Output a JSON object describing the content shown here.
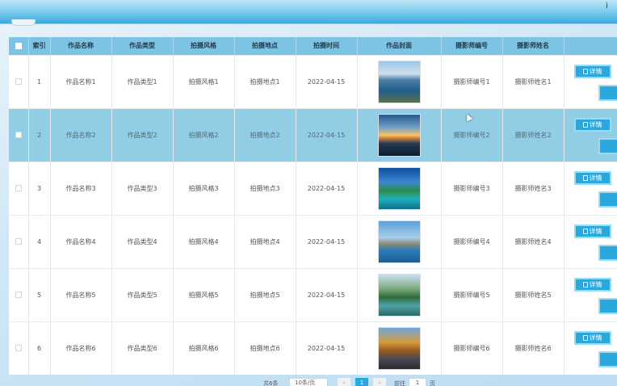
{
  "window": {
    "corner_glyph": "i"
  },
  "table": {
    "headers": [
      "索引",
      "作品名称",
      "作品类型",
      "拍摄风格",
      "拍摄地点",
      "拍摄时间",
      "作品封面",
      "摄影师编号",
      "摄影师姓名"
    ],
    "rows": [
      {
        "index": "1",
        "name": "作品名称1",
        "type": "作品类型1",
        "style": "拍摄风格1",
        "place": "拍摄地点1",
        "date": "2022-04-15",
        "cover": "lake-landscape-photo",
        "photographer_no": "摄影师编号1",
        "photographer_name": "摄影师姓名1",
        "selected": false
      },
      {
        "index": "2",
        "name": "作品名称2",
        "type": "作品类型2",
        "style": "拍摄风格2",
        "place": "拍摄地点2",
        "date": "2022-04-15",
        "cover": "sunset-sea-photo",
        "photographer_no": "摄影师编号2",
        "photographer_name": "摄影师姓名2",
        "selected": true
      },
      {
        "index": "3",
        "name": "作品名称3",
        "type": "作品类型3",
        "style": "拍摄风格3",
        "place": "拍摄地点3",
        "date": "2022-04-15",
        "cover": "tropical-island-photo",
        "photographer_no": "摄影师编号3",
        "photographer_name": "摄影师姓名3",
        "selected": false
      },
      {
        "index": "4",
        "name": "作品名称4",
        "type": "作品类型4",
        "style": "拍摄风格4",
        "place": "拍摄地点4",
        "date": "2022-04-15",
        "cover": "mountain-lake-photo",
        "photographer_no": "摄影师编号4",
        "photographer_name": "摄影师姓名4",
        "selected": false
      },
      {
        "index": "5",
        "name": "作品名称5",
        "type": "作品类型5",
        "style": "拍摄风格5",
        "place": "拍摄地点5",
        "date": "2022-04-15",
        "cover": "river-valley-photo",
        "photographer_no": "摄影师编号5",
        "photographer_name": "摄影师姓名5",
        "selected": false
      },
      {
        "index": "6",
        "name": "作品名称6",
        "type": "作品类型6",
        "style": "拍摄风格6",
        "place": "拍摄地点6",
        "date": "2022-04-15",
        "cover": "autumn-road-photo",
        "photographer_no": "摄影师编号6",
        "photographer_name": "摄影师姓名6",
        "selected": false
      }
    ],
    "detail_label": "详情"
  },
  "pager": {
    "total_label": "共6条",
    "page_size": "10条/页",
    "prev": "‹",
    "current": "1",
    "next": "›",
    "goto_label": "前往",
    "goto_value": "1",
    "goto_unit": "页"
  },
  "colors": {
    "accent": "#2aa8dd",
    "header": "#7dc3e3",
    "selected_row": "#92cde6"
  }
}
